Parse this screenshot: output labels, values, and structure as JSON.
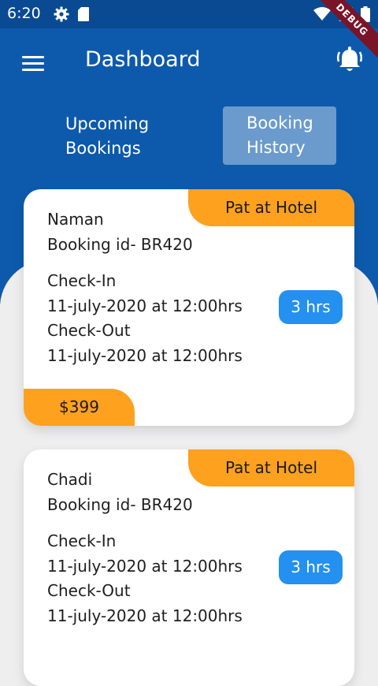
{
  "status_bar": {
    "time": "6:20",
    "debug_label": "DEBUG",
    "icons": [
      "gear-icon",
      "sd-card-icon",
      "wifi-icon",
      "signal-icon",
      "battery-icon"
    ]
  },
  "app_bar": {
    "title": "Dashboard",
    "menu_icon": "menu-icon",
    "notification_icon": "bell-icon"
  },
  "tabs": [
    {
      "line1": "Upcoming",
      "line2": "Bookings",
      "selected": false
    },
    {
      "line1": "Booking",
      "line2": "History",
      "selected": true
    }
  ],
  "colors": {
    "primary": "#0d5aad",
    "status_bar": "#0a4a92",
    "selected_tab": "#6b9bcd",
    "accent_orange": "#fda11f",
    "badge_blue": "#2490ef",
    "background": "#eeeeef"
  },
  "bookings": [
    {
      "status": "Pat at Hotel",
      "name": "Naman",
      "booking_id": "Booking id- BR420",
      "checkin_label": "Check-In",
      "checkin_value": "11-july-2020 at 12:00hrs",
      "checkout_label": "Check-Out",
      "checkout_value": "11-july-2020 at 12:00hrs",
      "duration": "3 hrs",
      "price": "$399"
    },
    {
      "status": "Pat at Hotel",
      "name": "Chadi",
      "booking_id": "Booking id- BR420",
      "checkin_label": "Check-In",
      "checkin_value": "11-july-2020 at 12:00hrs",
      "checkout_label": "Check-Out",
      "checkout_value": "11-july-2020 at 12:00hrs",
      "duration": "3 hrs"
    }
  ]
}
